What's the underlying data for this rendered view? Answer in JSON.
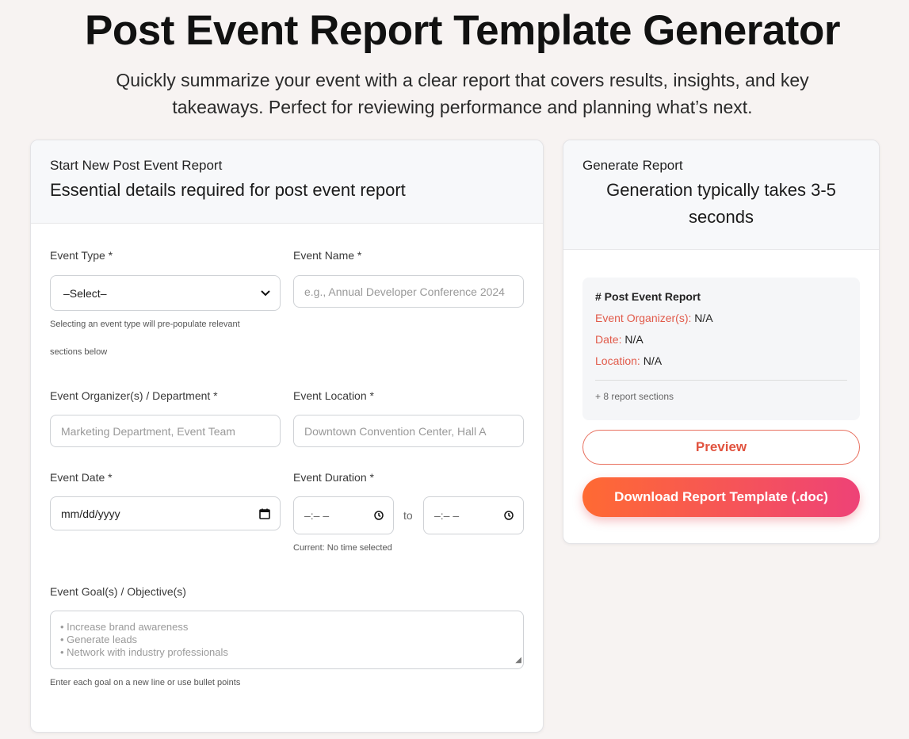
{
  "hero": {
    "title": "Post Event Report Template Generator",
    "subtitle": "Quickly summarize your event with a clear report that covers results, insights, and key takeaways. Perfect for reviewing performance and planning what’s next."
  },
  "form_card": {
    "small_title": "Start New Post Event Report",
    "big_title": "Essential details required for post event report",
    "event_type": {
      "label": "Event Type *",
      "value": "–Select–",
      "hint_line1": "Selecting an event type will pre-populate relevant",
      "hint_line2": "sections below"
    },
    "event_name": {
      "label": "Event Name *",
      "placeholder": "e.g., Annual Developer Conference 2024"
    },
    "organizer": {
      "label": "Event Organizer(s) / Department *",
      "placeholder": "Marketing Department, Event Team"
    },
    "location": {
      "label": "Event Location *",
      "placeholder": "Downtown Convention Center, Hall A"
    },
    "date": {
      "label": "Event Date *",
      "value": "mm/dd/yyyy"
    },
    "duration": {
      "label": "Event Duration *",
      "start_value": "–:– –",
      "to_label": "to",
      "end_value": "–:– –",
      "current": "Current: No time selected"
    },
    "goals": {
      "label": "Event Goal(s) / Objective(s)",
      "placeholder_1": "• Increase brand awareness",
      "placeholder_2": "• Generate leads",
      "placeholder_3": "• Network with industry professionals",
      "hint": "Enter each goal on a new line or use bullet points"
    }
  },
  "gen_card": {
    "small_title": "Generate Report",
    "big_title_line1": "Generation typically takes 3-5",
    "big_title_line2": "seconds",
    "preview": {
      "title": "# Post Event Report",
      "organizer_key": "Event Organizer(s):",
      "organizer_val": "N/A",
      "date_key": "Date:",
      "date_val": "N/A",
      "location_key": "Location:",
      "location_val": "N/A",
      "sections": "+ 8 report sections"
    },
    "preview_button": "Preview",
    "download_button": "Download Report Template (.doc)"
  },
  "colors": {
    "accent": "#e1533f",
    "gradient_start": "#ff6a33",
    "gradient_end": "#ee4277",
    "background": "#f7f3f2"
  },
  "icons": {
    "select": "chevron-down-icon",
    "date": "calendar-icon",
    "time": "clock-icon"
  }
}
